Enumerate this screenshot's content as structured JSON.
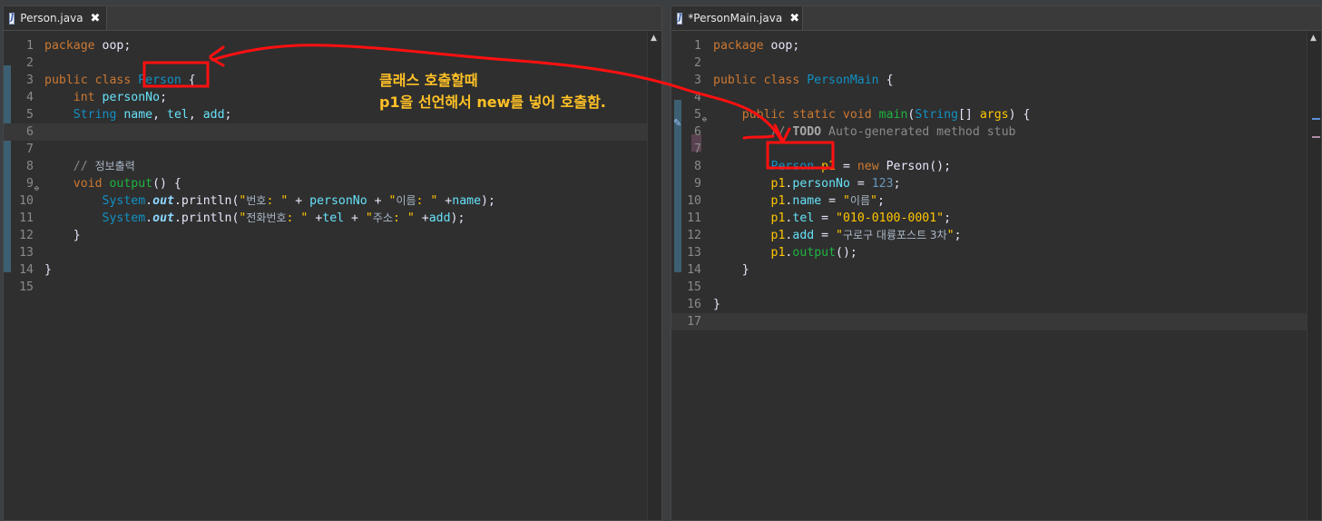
{
  "left_editor": {
    "tab": {
      "label": "Person.java",
      "close": "✖"
    },
    "lines": [
      {
        "n": "1",
        "segs": [
          [
            "kw",
            "package"
          ],
          [
            "op",
            " oop;"
          ]
        ]
      },
      {
        "n": "2",
        "segs": []
      },
      {
        "n": "3",
        "segs": [
          [
            "kw",
            "public class "
          ],
          [
            "cls",
            "Person"
          ],
          [
            "op",
            " {"
          ]
        ]
      },
      {
        "n": "4",
        "segs": [
          [
            "op",
            "    "
          ],
          [
            "kw",
            "int"
          ],
          [
            "fld",
            " personNo"
          ],
          [
            "op",
            ";"
          ]
        ]
      },
      {
        "n": "5",
        "segs": [
          [
            "op",
            "    "
          ],
          [
            "cls",
            "String"
          ],
          [
            "fld",
            " name"
          ],
          [
            "op",
            ", "
          ],
          [
            "fld",
            "tel"
          ],
          [
            "op",
            ", "
          ],
          [
            "fld",
            "add"
          ],
          [
            "op",
            ";"
          ]
        ]
      },
      {
        "n": "6",
        "segs": [],
        "current": true
      },
      {
        "n": "7",
        "segs": []
      },
      {
        "n": "8",
        "segs": [
          [
            "cmt",
            "    // "
          ],
          [
            "ko",
            "정보출력"
          ]
        ]
      },
      {
        "n": "9",
        "segs": [
          [
            "op",
            "    "
          ],
          [
            "kw",
            "void "
          ],
          [
            "fn",
            "output"
          ],
          [
            "op",
            "() {"
          ]
        ],
        "fold": true
      },
      {
        "n": "10",
        "segs": [
          [
            "op",
            "        "
          ],
          [
            "sys",
            "System"
          ],
          [
            "op",
            "."
          ],
          [
            "out",
            "out"
          ],
          [
            "op",
            ".println("
          ],
          [
            "str",
            "\""
          ],
          [
            "ko",
            "번호"
          ],
          [
            "str",
            ": \""
          ],
          [
            "op",
            " + "
          ],
          [
            "fld",
            "personNo"
          ],
          [
            "op",
            " + "
          ],
          [
            "str",
            "\""
          ],
          [
            "ko",
            "이름"
          ],
          [
            "str",
            ": \""
          ],
          [
            "op",
            " +"
          ],
          [
            "fld",
            "name"
          ],
          [
            "op",
            ");"
          ]
        ]
      },
      {
        "n": "11",
        "segs": [
          [
            "op",
            "        "
          ],
          [
            "sys",
            "System"
          ],
          [
            "op",
            "."
          ],
          [
            "out",
            "out"
          ],
          [
            "op",
            ".println("
          ],
          [
            "str",
            "\""
          ],
          [
            "ko",
            "전화번호"
          ],
          [
            "str",
            ": \""
          ],
          [
            "op",
            " +"
          ],
          [
            "fld",
            "tel"
          ],
          [
            "op",
            " + "
          ],
          [
            "str",
            "\""
          ],
          [
            "ko",
            "주소"
          ],
          [
            "str",
            ": \""
          ],
          [
            "op",
            " +"
          ],
          [
            "fld",
            "add"
          ],
          [
            "op",
            ");"
          ]
        ]
      },
      {
        "n": "12",
        "segs": [
          [
            "op",
            "    }"
          ]
        ]
      },
      {
        "n": "13",
        "segs": []
      },
      {
        "n": "14",
        "segs": [
          [
            "op",
            "}"
          ]
        ]
      },
      {
        "n": "15",
        "segs": []
      }
    ]
  },
  "right_editor": {
    "tab": {
      "label": "*PersonMain.java",
      "close": "✖"
    },
    "lines": [
      {
        "n": "1",
        "segs": [
          [
            "kw",
            "package"
          ],
          [
            "op",
            " oop;"
          ]
        ]
      },
      {
        "n": "2",
        "segs": []
      },
      {
        "n": "3",
        "segs": [
          [
            "kw",
            "public class "
          ],
          [
            "cls",
            "PersonMain"
          ],
          [
            "op",
            " {"
          ]
        ]
      },
      {
        "n": "4",
        "segs": []
      },
      {
        "n": "5",
        "segs": [
          [
            "op",
            "    "
          ],
          [
            "kw",
            "public static void "
          ],
          [
            "fn",
            "main"
          ],
          [
            "op",
            "("
          ],
          [
            "cls",
            "String"
          ],
          [
            "op",
            "[] "
          ],
          [
            "str",
            "args"
          ],
          [
            "op",
            ") {"
          ]
        ],
        "fold": true
      },
      {
        "n": "6",
        "segs": [
          [
            "cmt",
            "        // "
          ],
          [
            "todo",
            "TODO"
          ],
          [
            "cmt",
            " Auto-generated method stub"
          ]
        ]
      },
      {
        "n": "7",
        "segs": []
      },
      {
        "n": "8",
        "segs": [
          [
            "op",
            "        "
          ],
          [
            "cls",
            "Person"
          ],
          [
            "str",
            " p1"
          ],
          [
            "op",
            " = "
          ],
          [
            "kw",
            "new "
          ],
          [
            "op",
            "Person();"
          ]
        ]
      },
      {
        "n": "9",
        "segs": [
          [
            "op",
            "        "
          ],
          [
            "str",
            "p1"
          ],
          [
            "op",
            "."
          ],
          [
            "fld",
            "personNo"
          ],
          [
            "op",
            " = "
          ],
          [
            "num",
            "123"
          ],
          [
            "op",
            ";"
          ]
        ]
      },
      {
        "n": "10",
        "segs": [
          [
            "op",
            "        "
          ],
          [
            "str",
            "p1"
          ],
          [
            "op",
            "."
          ],
          [
            "fld",
            "name"
          ],
          [
            "op",
            " = "
          ],
          [
            "str",
            "\""
          ],
          [
            "ko",
            "이름"
          ],
          [
            "str",
            "\""
          ],
          [
            "op",
            ";"
          ]
        ]
      },
      {
        "n": "11",
        "segs": [
          [
            "op",
            "        "
          ],
          [
            "str",
            "p1"
          ],
          [
            "op",
            "."
          ],
          [
            "fld",
            "tel"
          ],
          [
            "op",
            " = "
          ],
          [
            "str",
            "\"010-0100-0001\""
          ],
          [
            "op",
            ";"
          ]
        ]
      },
      {
        "n": "12",
        "segs": [
          [
            "op",
            "        "
          ],
          [
            "str",
            "p1"
          ],
          [
            "op",
            "."
          ],
          [
            "fld",
            "add"
          ],
          [
            "op",
            " = "
          ],
          [
            "str",
            "\""
          ],
          [
            "ko",
            "구로구 대륭포스트 3차"
          ],
          [
            "str",
            "\""
          ],
          [
            "op",
            ";"
          ]
        ]
      },
      {
        "n": "13",
        "segs": [
          [
            "op",
            "        "
          ],
          [
            "str",
            "p1"
          ],
          [
            "op",
            "."
          ],
          [
            "fn",
            "output"
          ],
          [
            "op",
            "();"
          ]
        ]
      },
      {
        "n": "14",
        "segs": [
          [
            "op",
            "    }"
          ]
        ]
      },
      {
        "n": "15",
        "segs": []
      },
      {
        "n": "16",
        "segs": [
          [
            "op",
            "}"
          ]
        ]
      },
      {
        "n": "17",
        "segs": [],
        "current": true
      }
    ]
  },
  "annotation": {
    "line1": "클래스 호출할때",
    "line2": "p1을 선언해서 new를 넣어 호출함."
  },
  "colors": {
    "annotation_red": "#ff1010",
    "annotation_text": "#ffc126"
  }
}
